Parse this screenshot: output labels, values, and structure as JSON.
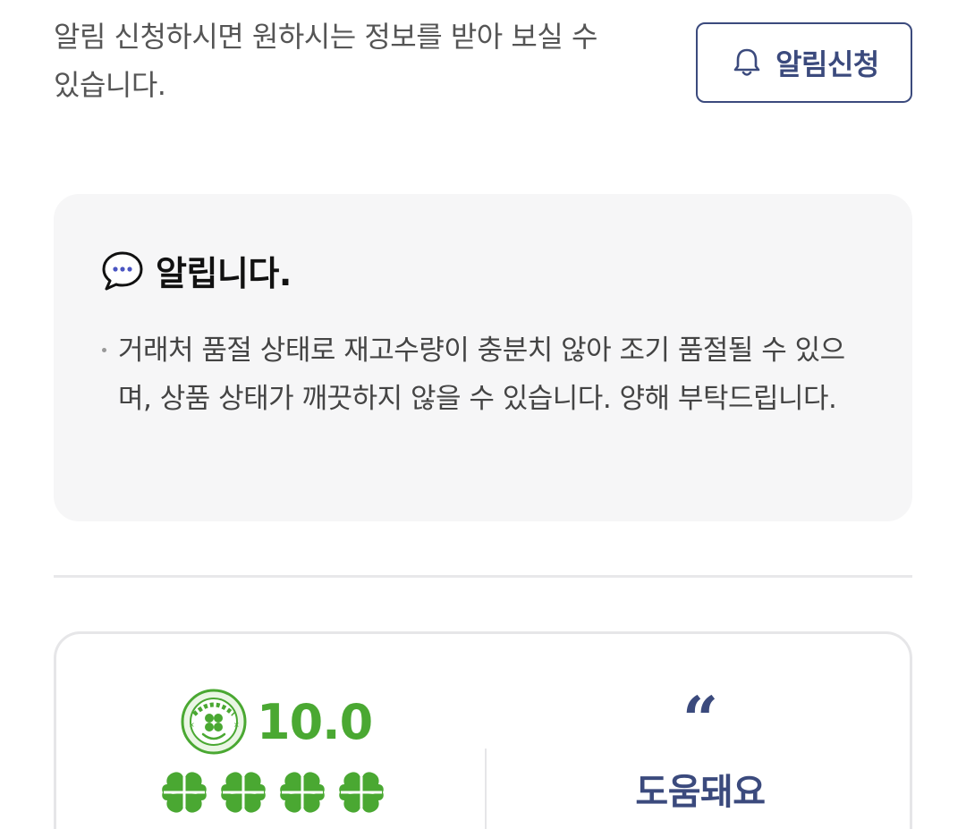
{
  "notify": {
    "description": "알림 신청하시면 원하시는 정보를 받아 보실 수 있습니다.",
    "button_label": "알림신청",
    "button_icon": "bell-icon"
  },
  "notice": {
    "icon": "chat-bubble-icon",
    "title": "알립니다.",
    "items": [
      "거래처 품절 상태로 재고수량이 충분치 않아 조기 품절될 수 있으며, 상품 상태가 깨끗하지 않을 수 있습니다. 양해 부탁드립니다."
    ]
  },
  "review": {
    "score": "10.0",
    "badge_icon": "feel-lucky-badge-icon",
    "rating_max": 4,
    "rating": 4,
    "quote_mark": "“",
    "comment": "도움돼요"
  },
  "colors": {
    "accent_navy": "#3b4a7d",
    "accent_green": "#4aa832",
    "box_bg": "#f6f6f7"
  }
}
